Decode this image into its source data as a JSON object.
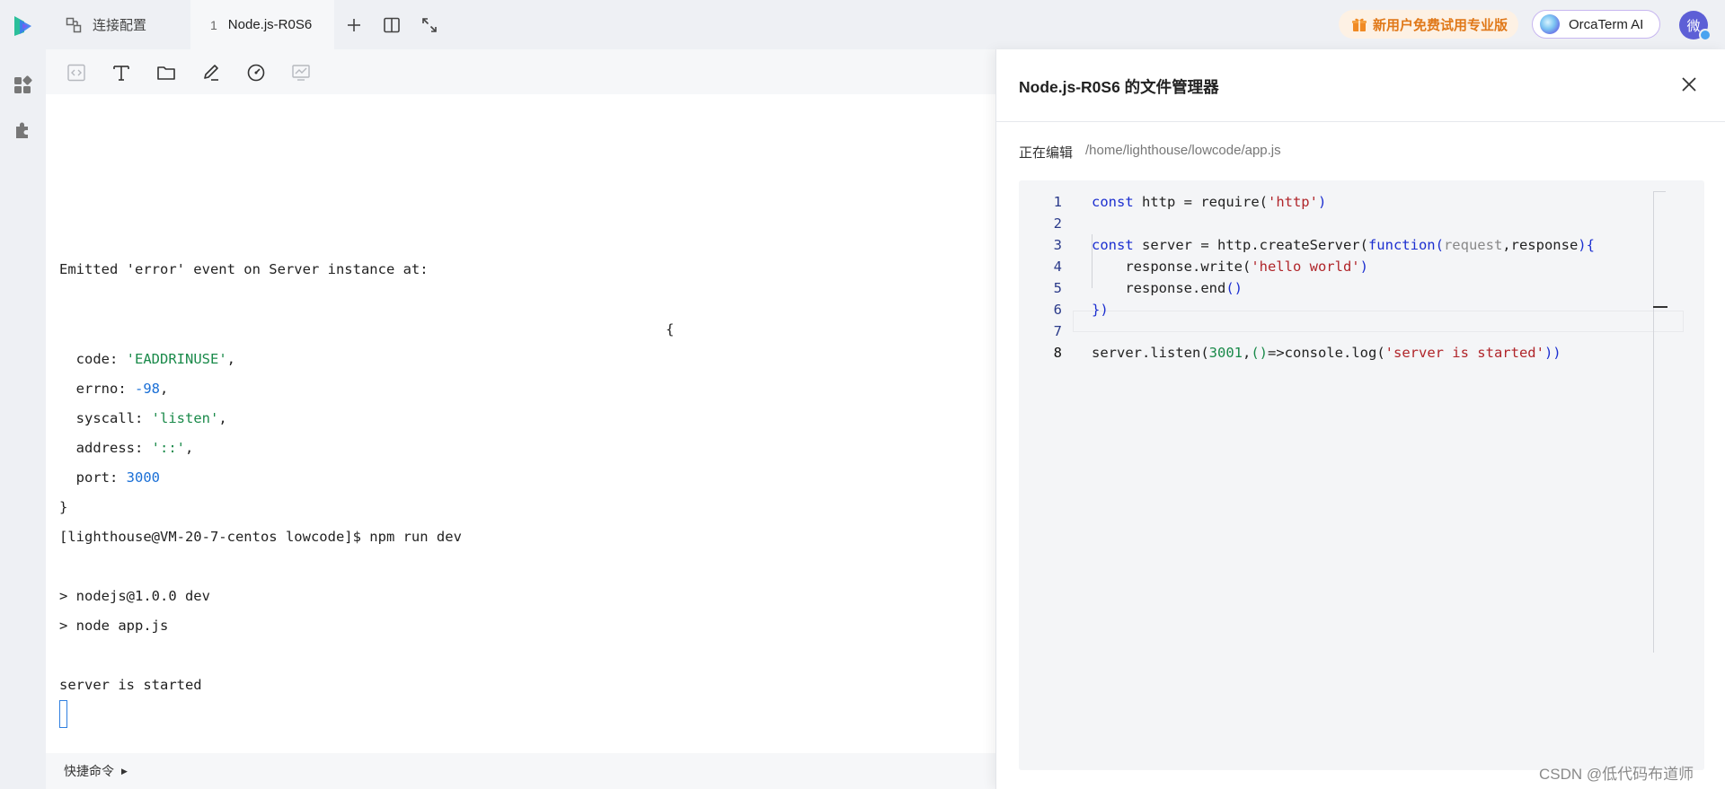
{
  "tabs": {
    "config_label": "连接配置",
    "active_index": "1",
    "active_label": "Node.js-R0S6"
  },
  "header": {
    "promo_label": "新用户免费试用专业版",
    "ai_label": "OrcaTerm AI",
    "avatar_text": "微"
  },
  "terminal": {
    "lines": [
      "Emitted 'error' event on Server instance at:",
      "{",
      "}",
      "[lighthouse@VM-20-7-centos lowcode]$ npm run dev",
      "> nodejs@1.0.0 dev",
      "> node app.js",
      "server is started"
    ],
    "error_fields": [
      {
        "key": "code",
        "value": "'EADDRINUSE'"
      },
      {
        "key": "errno",
        "value": "-98"
      },
      {
        "key": "syscall",
        "value": "'listen'"
      },
      {
        "key": "address",
        "value": "'::'"
      },
      {
        "key": "port",
        "value": "3000"
      }
    ]
  },
  "quickbar": {
    "label": "快捷命令"
  },
  "file_manager": {
    "title": "Node.js-R0S6 的文件管理器",
    "editing_label": "正在编辑",
    "file_path": "/home/lighthouse/lowcode/app.js",
    "line_numbers": [
      "1",
      "2",
      "3",
      "4",
      "5",
      "6",
      "7",
      "8"
    ],
    "code": {
      "l1_const": "const",
      "l1_rest": " http = require(",
      "l1_str": "'http'",
      "l1_close": ")",
      "l3_const": "const",
      "l3_rest": " server = http.createServer(",
      "l3_function": "function",
      "l3_paren": "(",
      "l3_request": "request",
      "l3_args": ",response",
      "l3_close": "){",
      "l4_call": "    response.write(",
      "l4_str": "'hello world'",
      "l4_close": ")",
      "l5_call": "    response.end",
      "l5_paren": "()",
      "l6": "})",
      "l8_call": "server.listen(",
      "l8_num": "3001",
      "l8_mid": ",",
      "l8_arrow_paren": "()",
      "l8_arrow": "=>console.log(",
      "l8_str": "'server is started'",
      "l8_close": "))"
    }
  },
  "watermark": "CSDN @低代码布道师",
  "colors": {
    "keyword": "#1c2fd0",
    "string": "#b0252a",
    "number": "#1a8a4a",
    "promo": "#e07818",
    "cursor": "#2f7fe0"
  }
}
